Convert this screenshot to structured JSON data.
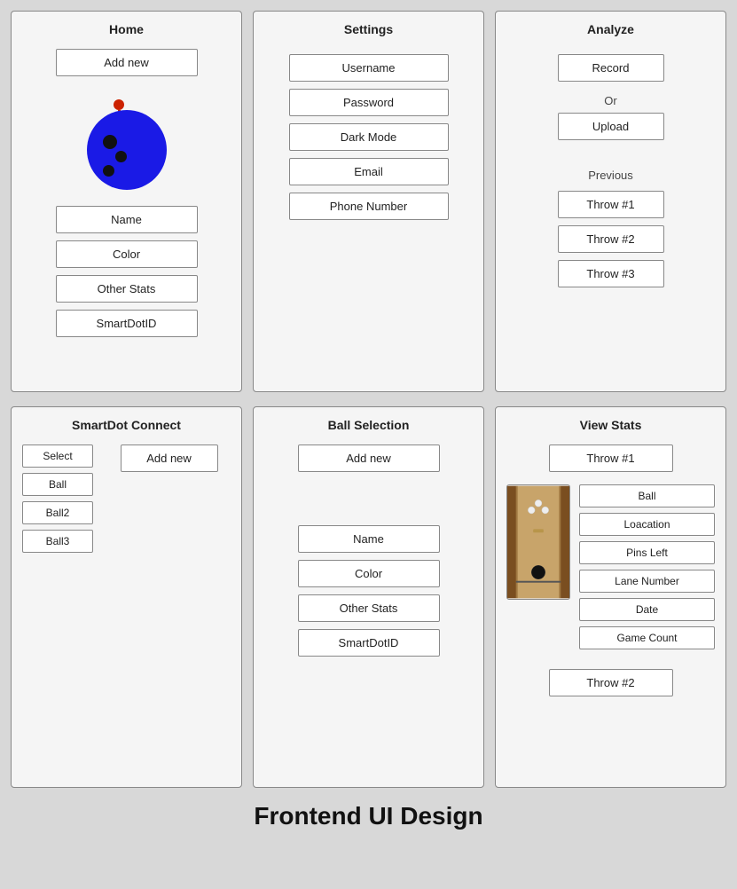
{
  "panels": {
    "home": {
      "title": "Home",
      "add_btn": "Add new",
      "stats_btns": [
        "Name",
        "Color",
        "Other Stats",
        "SmartDotID"
      ]
    },
    "settings": {
      "title": "Settings",
      "fields": [
        "Username",
        "Password",
        "Dark Mode",
        "Email",
        "Phone Number"
      ]
    },
    "analyze": {
      "title": "Analyze",
      "record_btn": "Record",
      "or_text": "Or",
      "upload_btn": "Upload",
      "previous_label": "Previous",
      "throw_btns": [
        "Throw #1",
        "Throw #2",
        "Throw #3"
      ]
    },
    "smartdot": {
      "title": "SmartDot Connect",
      "list_items": [
        "Select",
        "Ball",
        "Ball2",
        "Ball3"
      ],
      "add_btn": "Add new"
    },
    "ball_selection": {
      "title": "Ball Selection",
      "add_btn": "Add new",
      "stat_fields": [
        "Name",
        "Color",
        "Other Stats",
        "SmartDotID"
      ]
    },
    "view_stats": {
      "title": "View Stats",
      "throw1_label": "Throw #1",
      "throw2_label": "Throw #2",
      "stat_fields": [
        "Ball",
        "Loacation",
        "Pins Left",
        "Lane Number",
        "Date",
        "Game Count"
      ]
    }
  },
  "footer": {
    "title": "Frontend UI Design"
  }
}
